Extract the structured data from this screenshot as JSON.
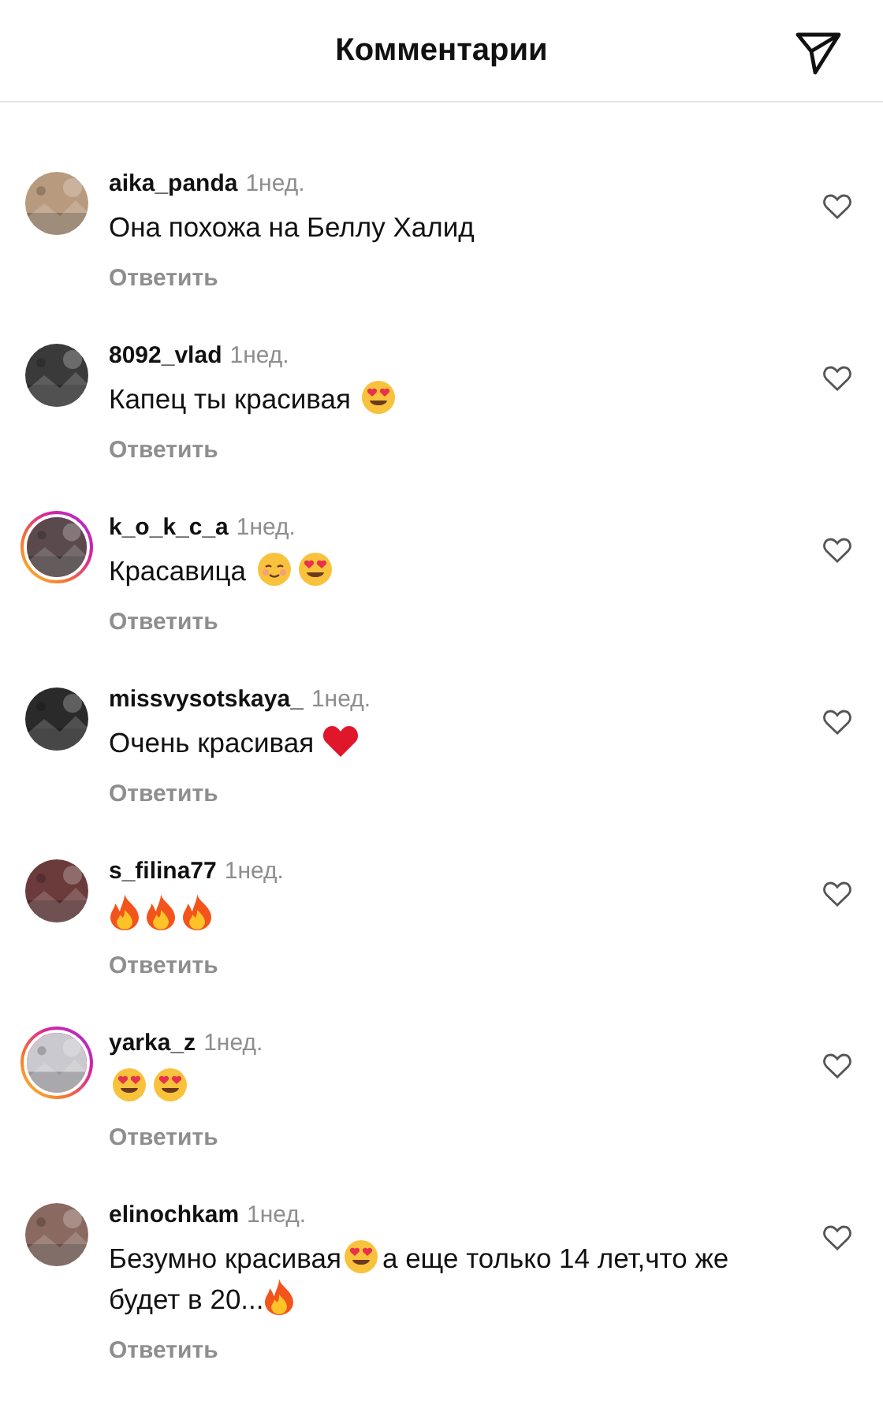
{
  "header": {
    "title": "Комментарии"
  },
  "comments": [
    {
      "username": "aika_panda",
      "time": "1нед.",
      "story_ring": false,
      "liked": false,
      "reply": "Ответить",
      "segments": [
        {
          "kind": "text",
          "text": "Она похожа на Беллу Халид"
        }
      ]
    },
    {
      "username": "8092_vlad",
      "time": "1нед.",
      "story_ring": false,
      "liked": false,
      "reply": "Ответить",
      "segments": [
        {
          "kind": "text",
          "text": "Капец ты красивая "
        },
        {
          "kind": "heart-eyes"
        }
      ]
    },
    {
      "username": "k_o_k_c_a",
      "time": "1нед.",
      "story_ring": true,
      "liked": false,
      "reply": "Ответить",
      "segments": [
        {
          "kind": "text",
          "text": "Красавица "
        },
        {
          "kind": "smiling"
        },
        {
          "kind": "heart-eyes"
        }
      ]
    },
    {
      "username": "missvysotskaya_",
      "time": "1нед.",
      "story_ring": false,
      "liked": false,
      "reply": "Ответить",
      "segments": [
        {
          "kind": "text",
          "text": "Очень красивая "
        },
        {
          "kind": "red-heart"
        }
      ]
    },
    {
      "username": "s_filina77",
      "time": "1нед.",
      "story_ring": false,
      "liked": false,
      "reply": "Ответить",
      "segments": [
        {
          "kind": "fire"
        },
        {
          "kind": "fire"
        },
        {
          "kind": "fire"
        }
      ]
    },
    {
      "username": "yarka_z",
      "time": "1нед.",
      "story_ring": true,
      "liked": false,
      "reply": "Ответить",
      "segments": [
        {
          "kind": "heart-eyes"
        },
        {
          "kind": "heart-eyes"
        }
      ]
    },
    {
      "username": "elinochkam",
      "time": "1нед.",
      "story_ring": false,
      "liked": false,
      "reply": "Ответить",
      "segments": [
        {
          "kind": "text",
          "text": "Безумно красивая"
        },
        {
          "kind": "heart-eyes"
        },
        {
          "kind": "text",
          "text": "а еще только 14 лет,что же будет в 20..."
        },
        {
          "kind": "fire"
        }
      ]
    }
  ]
}
